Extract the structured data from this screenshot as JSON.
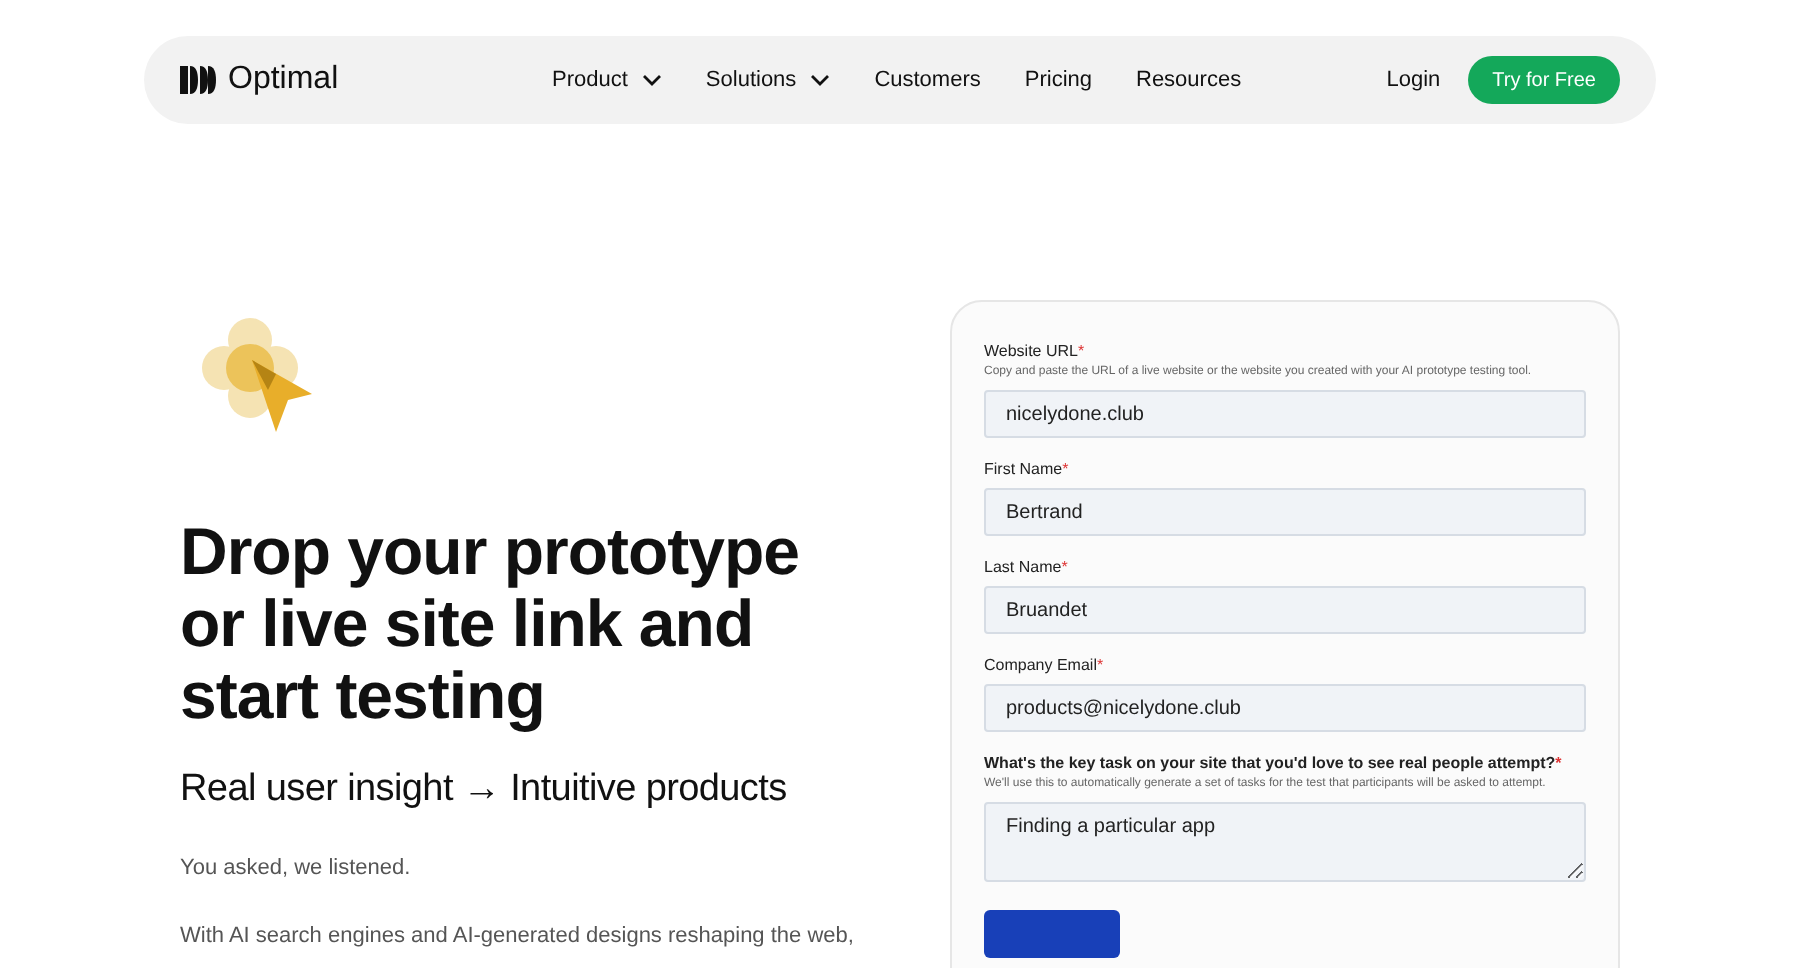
{
  "nav": {
    "logo": "Optimal",
    "items": [
      {
        "label": "Product",
        "dropdown": true
      },
      {
        "label": "Solutions",
        "dropdown": true
      },
      {
        "label": "Customers",
        "dropdown": false
      },
      {
        "label": "Pricing",
        "dropdown": false
      },
      {
        "label": "Resources",
        "dropdown": false
      }
    ],
    "login": "Login",
    "cta": "Try for Free"
  },
  "hero": {
    "heading": "Drop your prototype or live site link and start testing",
    "subheading": "Real user insight → Intuitive products",
    "paragraphs": [
      "You asked, we listened.",
      "With AI search engines and AI-generated designs reshaping the web,"
    ]
  },
  "form": {
    "fields": [
      {
        "kind": "input",
        "label": "Website URL",
        "mark": "*",
        "help": "Copy and paste the URL of a live website or the website you created with your AI prototype testing tool.",
        "value": "nicelydone.club"
      },
      {
        "kind": "input",
        "label": "First Name",
        "mark": "*",
        "value": "Bertrand"
      },
      {
        "kind": "input",
        "label": "Last Name",
        "mark": "*",
        "value": "Bruandet"
      },
      {
        "kind": "input",
        "label": "Company Email",
        "mark": "*",
        "value": "products@nicelydone.club"
      },
      {
        "kind": "textarea",
        "label": "What's the key task on your site that you'd love to see real people attempt?",
        "mark": "*",
        "help": "We'll use this to automatically generate a set of tasks for the test that participants will be asked to attempt.",
        "value": "Finding a particular app"
      }
    ]
  }
}
